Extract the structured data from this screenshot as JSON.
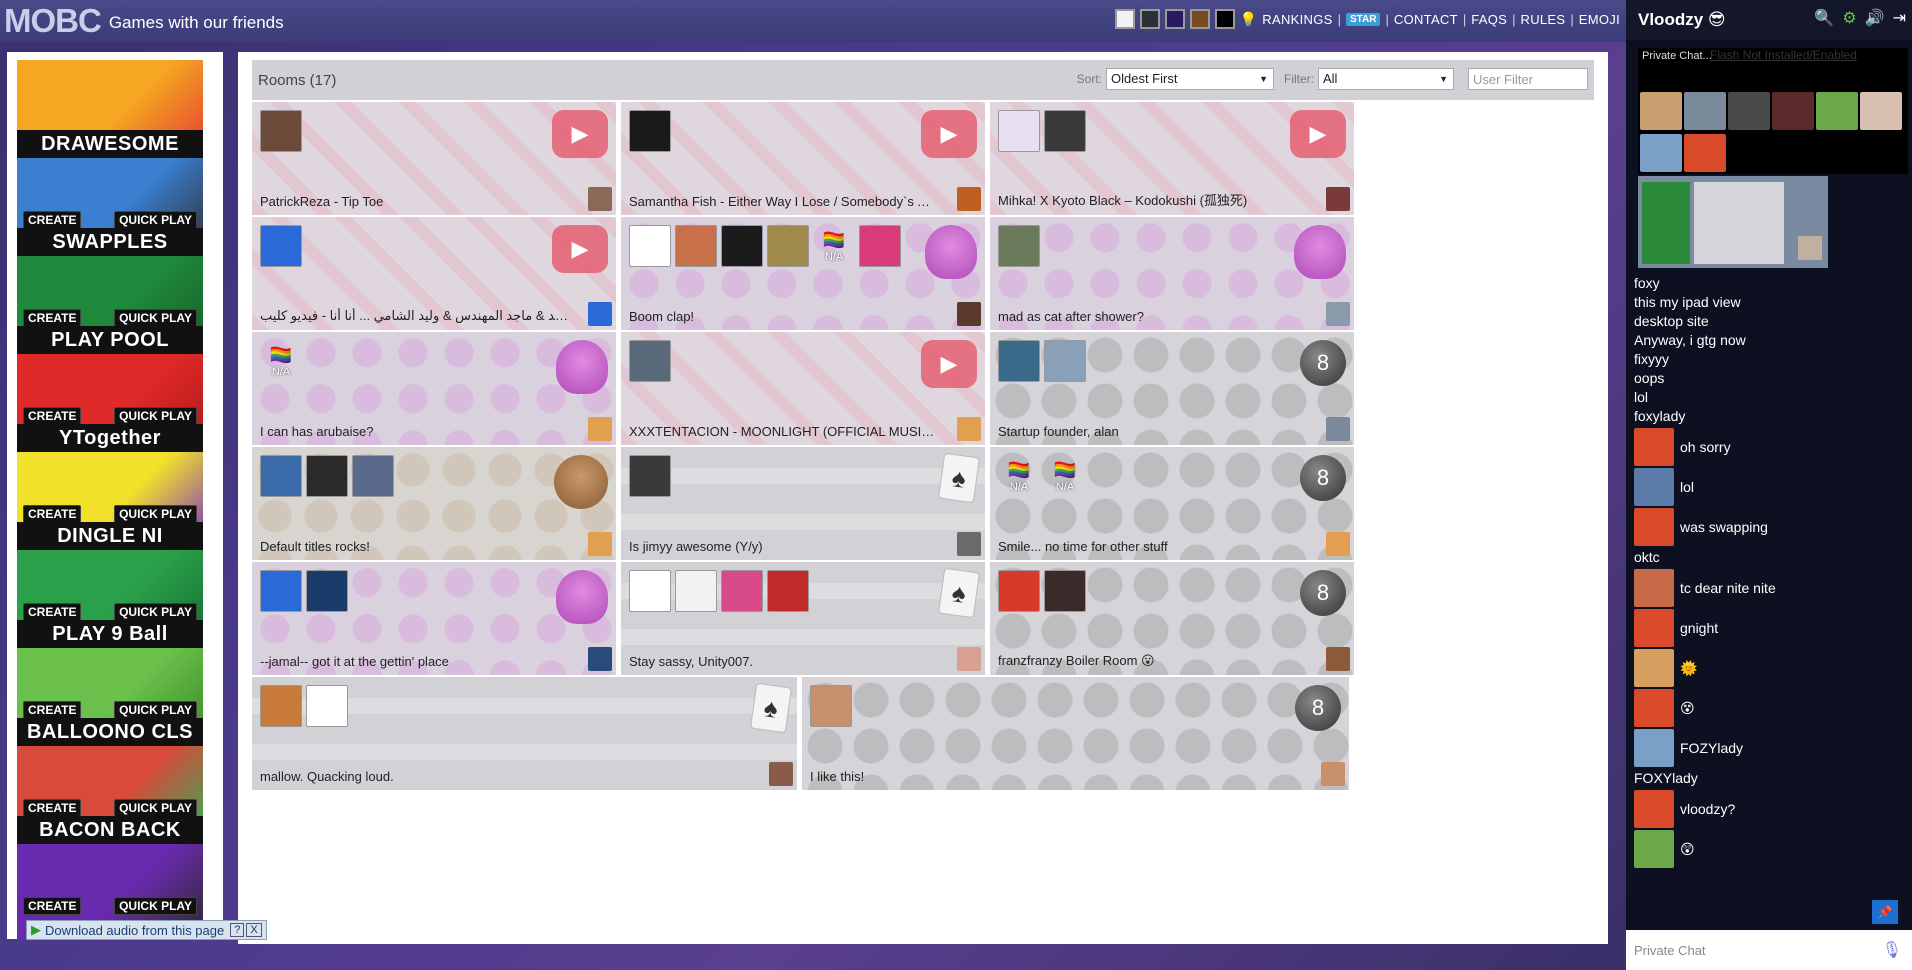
{
  "app": {
    "logo": "MOBC",
    "tagline": "Games with our friends"
  },
  "nav": {
    "swatches": [
      "#f2f2f2",
      "#2c2f36",
      "#2a1c5c",
      "#7a4a22",
      "#000000"
    ],
    "links": [
      "RANKINGS",
      "STAR",
      "CONTACT",
      "FAQS",
      "RULES",
      "EMOJI"
    ]
  },
  "games": [
    {
      "title": "DRAWESOME",
      "create": "CREATE",
      "quick": "QUICK PLAY",
      "colors": [
        "#f5a623",
        "#e53e2e"
      ],
      "show_btns": false
    },
    {
      "title": "SWAPPLES",
      "create": "CREATE",
      "quick": "QUICK PLAY",
      "colors": [
        "#3b7fd1",
        "#2e2e2e"
      ],
      "show_btns": true
    },
    {
      "title": "PLAY POOL",
      "create": "CREATE",
      "quick": "QUICK PLAY",
      "colors": [
        "#1f8a3b",
        "#155f28"
      ],
      "show_btns": true
    },
    {
      "title": "YTogether",
      "create": "CREATE",
      "quick": "QUICK PLAY",
      "colors": [
        "#e02a2a",
        "#b01818"
      ],
      "show_btns": true
    },
    {
      "title": "DINGLE NI",
      "create": "CREATE",
      "quick": "QUICK PLAY",
      "colors": [
        "#f1e12a",
        "#7a2cc6"
      ],
      "show_btns": true
    },
    {
      "title": "PLAY 9 Ball",
      "create": "CREATE",
      "quick": "QUICK PLAY",
      "colors": [
        "#2aa04a",
        "#166c30"
      ],
      "show_btns": true
    },
    {
      "title": "BALLOONO CLS",
      "create": "CREATE",
      "quick": "QUICK PLAY",
      "colors": [
        "#6ac04a",
        "#3a8a28"
      ],
      "show_btns": true
    },
    {
      "title": "BACON BACK",
      "create": "CREATE",
      "quick": "QUICK PLAY",
      "colors": [
        "#d84a3a",
        "#2ab05a"
      ],
      "show_btns": true
    },
    {
      "title": "",
      "create": "CREATE",
      "quick": "QUICK PLAY",
      "colors": [
        "#6a2ab0",
        "#2a2a2a"
      ],
      "show_btns": true
    }
  ],
  "rooms": {
    "title": "Rooms (17)",
    "sort_label": "Sort:",
    "sort_value": "Oldest First",
    "filter_label": "Filter:",
    "filter_value": "All",
    "user_filter_placeholder": "User Filter",
    "list": [
      {
        "title": "PatrickReza - Tip Toe",
        "pattern": "yt",
        "avatars": [
          "#6b4a3a"
        ],
        "thumb": "#8a6a55"
      },
      {
        "title": "Samantha Fish - Either Way I Lose / Somebody`s Always...",
        "pattern": "yt",
        "avatars": [
          "#1a1a1a"
        ],
        "thumb": "#c06020"
      },
      {
        "title": "Mihka! X Kyoto Black – Kodokushi (孤独死)",
        "pattern": "yt",
        "avatars": [
          "#e8e0f0",
          "#3a3a3a"
        ],
        "thumb": "#7a3a3a"
      },
      {
        "title": "راشد الماجد & ماجد المهندس & وليد الشامي ... أنا أنا - فيديو كليب",
        "pattern": "yt",
        "avatars": [
          "#2a6ad8"
        ],
        "thumb": "#2a6ad8"
      },
      {
        "title": "Boom clap!",
        "pattern": "ghost",
        "avatars": [
          "#ffffff",
          "#c8704a",
          "#1a1a1a",
          "#a08a4a",
          "na",
          "#d83a7a"
        ],
        "thumb": "#5a3a2a"
      },
      {
        "title": "mad as cat after shower?",
        "pattern": "ghost",
        "avatars": [
          "#6a7a5a"
        ],
        "thumb": "#8a9aaa"
      },
      {
        "title": "I can has arubaise?",
        "pattern": "ghost",
        "avatars": [
          "na"
        ],
        "thumb": "#e0a050"
      },
      {
        "title": "XXXTENTACION - MOONLIGHT (OFFICIAL MUSIC VIDEO)",
        "pattern": "yt",
        "avatars": [
          "#5a6a7a"
        ],
        "thumb": "#e0a050"
      },
      {
        "title": "Startup founder, alan",
        "pattern": "ball",
        "avatars": [
          "#3a6a8a",
          "#8aa0b8"
        ],
        "thumb": "#7a8a9a"
      },
      {
        "title": "Default titles rocks!",
        "pattern": "monkey",
        "avatars": [
          "#3a6aa8",
          "#2a2a2a",
          "#5a6a8a"
        ],
        "thumb": "#e0a050"
      },
      {
        "title": "Is jimyy awesome (Y/y)",
        "pattern": "card",
        "avatars": [
          "#3a3a3a"
        ],
        "thumb": "#6a6a6a"
      },
      {
        "title": "Smile... no time for other stuff",
        "pattern": "ball",
        "avatars": [
          "na",
          "na"
        ],
        "thumb": "#e0a050"
      },
      {
        "title": "--jamal-- got it at the gettin' place",
        "pattern": "ghost",
        "avatars": [
          "#2a6ad8",
          "#1a3a6a"
        ],
        "thumb": "#2a4a7a"
      },
      {
        "title": "Stay sassy, Unity007.",
        "pattern": "card",
        "avatars": [
          "#ffffff",
          "#f2f2f2",
          "#d84a8a",
          "#c02a2a"
        ],
        "thumb": "#d8a090"
      },
      {
        "title": "franzfranzy Boiler Room 😮",
        "pattern": "ball",
        "avatars": [
          "#d83a2a",
          "#3a2a2a"
        ],
        "thumb": "#8a5a3a"
      },
      {
        "title": "mallow. Quacking loud.",
        "pattern": "card",
        "avatars": [
          "#c87a3a",
          "#ffffff"
        ],
        "thumb": "#8a5a4a"
      },
      {
        "title": "I like this!",
        "pattern": "ball",
        "avatars": [
          "#c8906a"
        ],
        "thumb": "#c8906a"
      }
    ]
  },
  "chat": {
    "user": "Vloodzy 😎",
    "private_chat_label": "Private Chat...",
    "flash_notice": "Flash Not Installed/Enabled",
    "log": [
      {
        "type": "line",
        "text": "foxy"
      },
      {
        "type": "line",
        "text": "this my ipad view"
      },
      {
        "type": "line",
        "text": "desktop site"
      },
      {
        "type": "line",
        "text": "Anyway, i gtg now"
      },
      {
        "type": "line",
        "text": "fixyyy"
      },
      {
        "type": "line",
        "text": "oops"
      },
      {
        "type": "line",
        "text": "lol"
      },
      {
        "type": "line",
        "text": "foxylady"
      },
      {
        "type": "row",
        "text": "oh sorry",
        "color": "#d84a2a"
      },
      {
        "type": "row",
        "text": "lol",
        "color": "#5a7aa8"
      },
      {
        "type": "row",
        "text": "was swapping",
        "color": "#d84a2a"
      },
      {
        "type": "line",
        "text": "oktc"
      },
      {
        "type": "row",
        "text": "tc dear nite nite",
        "color": "#c86a4a"
      },
      {
        "type": "row",
        "text": "gnight",
        "color": "#d84a2a"
      },
      {
        "type": "row",
        "text": "🌞",
        "color": "#d8a060"
      },
      {
        "type": "row",
        "text": "😵",
        "color": "#d84a2a"
      },
      {
        "type": "row",
        "text": "FOZYlady",
        "color": "#7aa0c8"
      },
      {
        "type": "line",
        "text": "FOXYlady"
      },
      {
        "type": "row",
        "text": "vloodzy?",
        "color": "#d84a2a"
      },
      {
        "type": "row",
        "text": "😲",
        "color": "#6aa84a"
      }
    ],
    "input_placeholder": "Private Chat"
  },
  "download_bar": {
    "text": "Download audio from this page",
    "help": "?",
    "close": "X"
  }
}
